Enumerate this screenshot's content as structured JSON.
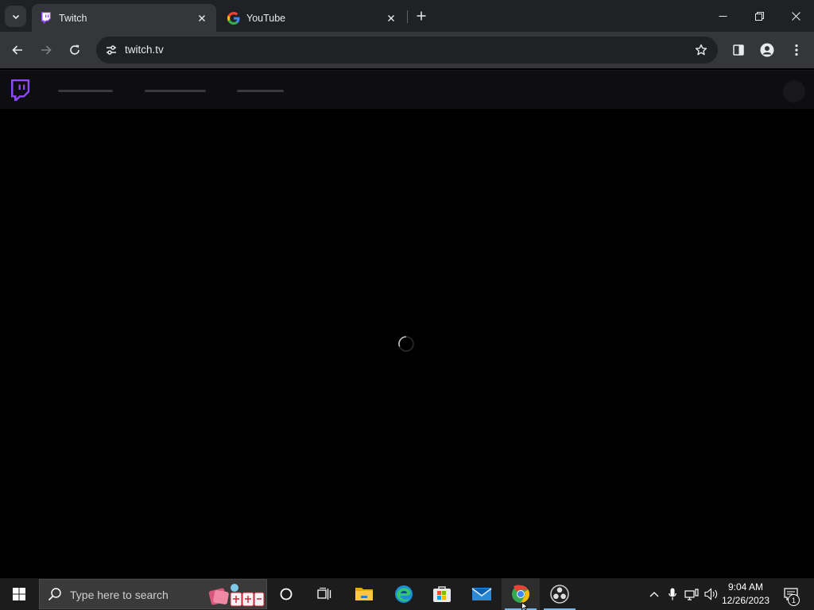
{
  "browser": {
    "tabs": [
      {
        "title": "Twitch",
        "favicon": "twitch-favicon",
        "active": true
      },
      {
        "title": "YouTube",
        "favicon": "google-favicon",
        "active": false
      }
    ],
    "address": {
      "url": "twitch.tv",
      "site_info_icon": "tune-icon"
    },
    "window_controls": [
      "minimize-icon",
      "restore-icon",
      "close-icon"
    ],
    "toolbar_icons": [
      "back-icon",
      "forward-icon",
      "reload-icon",
      "star-icon",
      "side-panel-icon",
      "profile-icon",
      "menu-icon"
    ]
  },
  "page": {
    "site": "twitch",
    "logo": "twitch-logo",
    "state": "loading",
    "colors": {
      "brand": "#9146ff",
      "nav_bg": "#0e0e10",
      "page_bg": "#000000"
    }
  },
  "taskbar": {
    "search_placeholder": "Type here to search",
    "apps": [
      {
        "name": "cortana",
        "icon": "cortana-icon"
      },
      {
        "name": "task-view",
        "icon": "task-view-icon"
      },
      {
        "name": "file-explorer",
        "icon": "folder-icon"
      },
      {
        "name": "edge",
        "icon": "edge-icon"
      },
      {
        "name": "store",
        "icon": "store-icon"
      },
      {
        "name": "mail",
        "icon": "mail-icon"
      },
      {
        "name": "chrome",
        "icon": "chrome-icon",
        "active": true
      },
      {
        "name": "obs",
        "icon": "obs-icon"
      }
    ],
    "clock": {
      "time": "9:04 AM",
      "date": "12/26/2023"
    },
    "notifications": "1"
  }
}
